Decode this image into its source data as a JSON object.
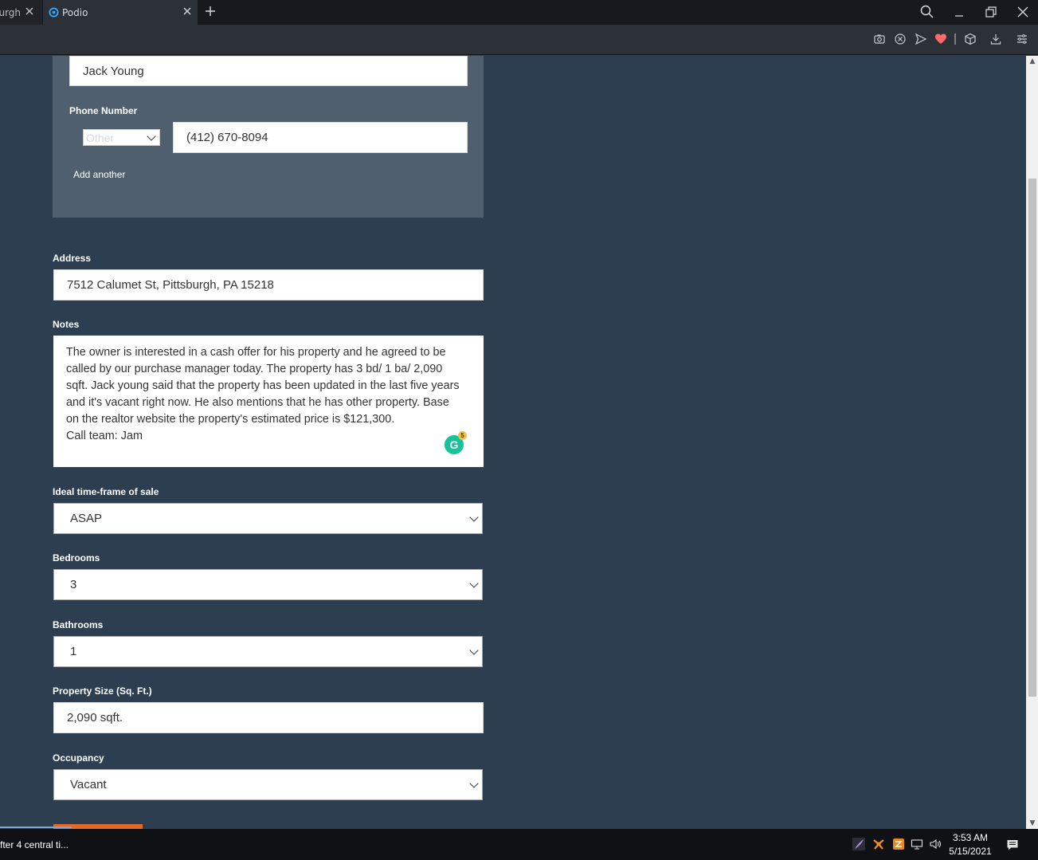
{
  "browser": {
    "prev_tab_title": "Pittsburgh",
    "active_tab_title": "Podio"
  },
  "contact": {
    "name_value": "Jack Young",
    "phone_label": "Phone Number",
    "phone_type": "Other",
    "phone_value": "(412) 670-8094",
    "add_another": "Add another"
  },
  "form": {
    "address_label": "Address",
    "address_value": "7512 Calumet St, Pittsburgh, PA 15218",
    "notes_label": "Notes",
    "notes_value": "The owner is interested in a cash offer for his property and he agreed to be\ncalled by our purchase manager today. The property has 3 bd/ 1 ba/ 2,090\nsqft. Jack young said that the property has been updated in the last five years\nand it's vacant right now. He also mentions that he has other property. Base\non the realtor website the property's estimated price is $121,300.\nCall team: Jam",
    "grammarly_count": "5",
    "timeframe_label": "Ideal time-frame of sale",
    "timeframe_value": "ASAP",
    "bedrooms_label": "Bedrooms",
    "bedrooms_value": "3",
    "bathrooms_label": "Bathrooms",
    "bathrooms_value": "1",
    "size_label": "Property Size (Sq. Ft.)",
    "size_value": "2,090 sqft.",
    "occupancy_label": "Occupancy",
    "occupancy_value": "Vacant"
  },
  "taskbar": {
    "task_label": "fter 4 central ti...",
    "time": "3:53 AM",
    "date": "5/15/2021"
  },
  "colors": {
    "page_bg": "#2c3e50",
    "contact_box_bg": "#4f5f6e",
    "accent_orange": "#e06a2c",
    "grammarly_green": "#15c39a"
  }
}
